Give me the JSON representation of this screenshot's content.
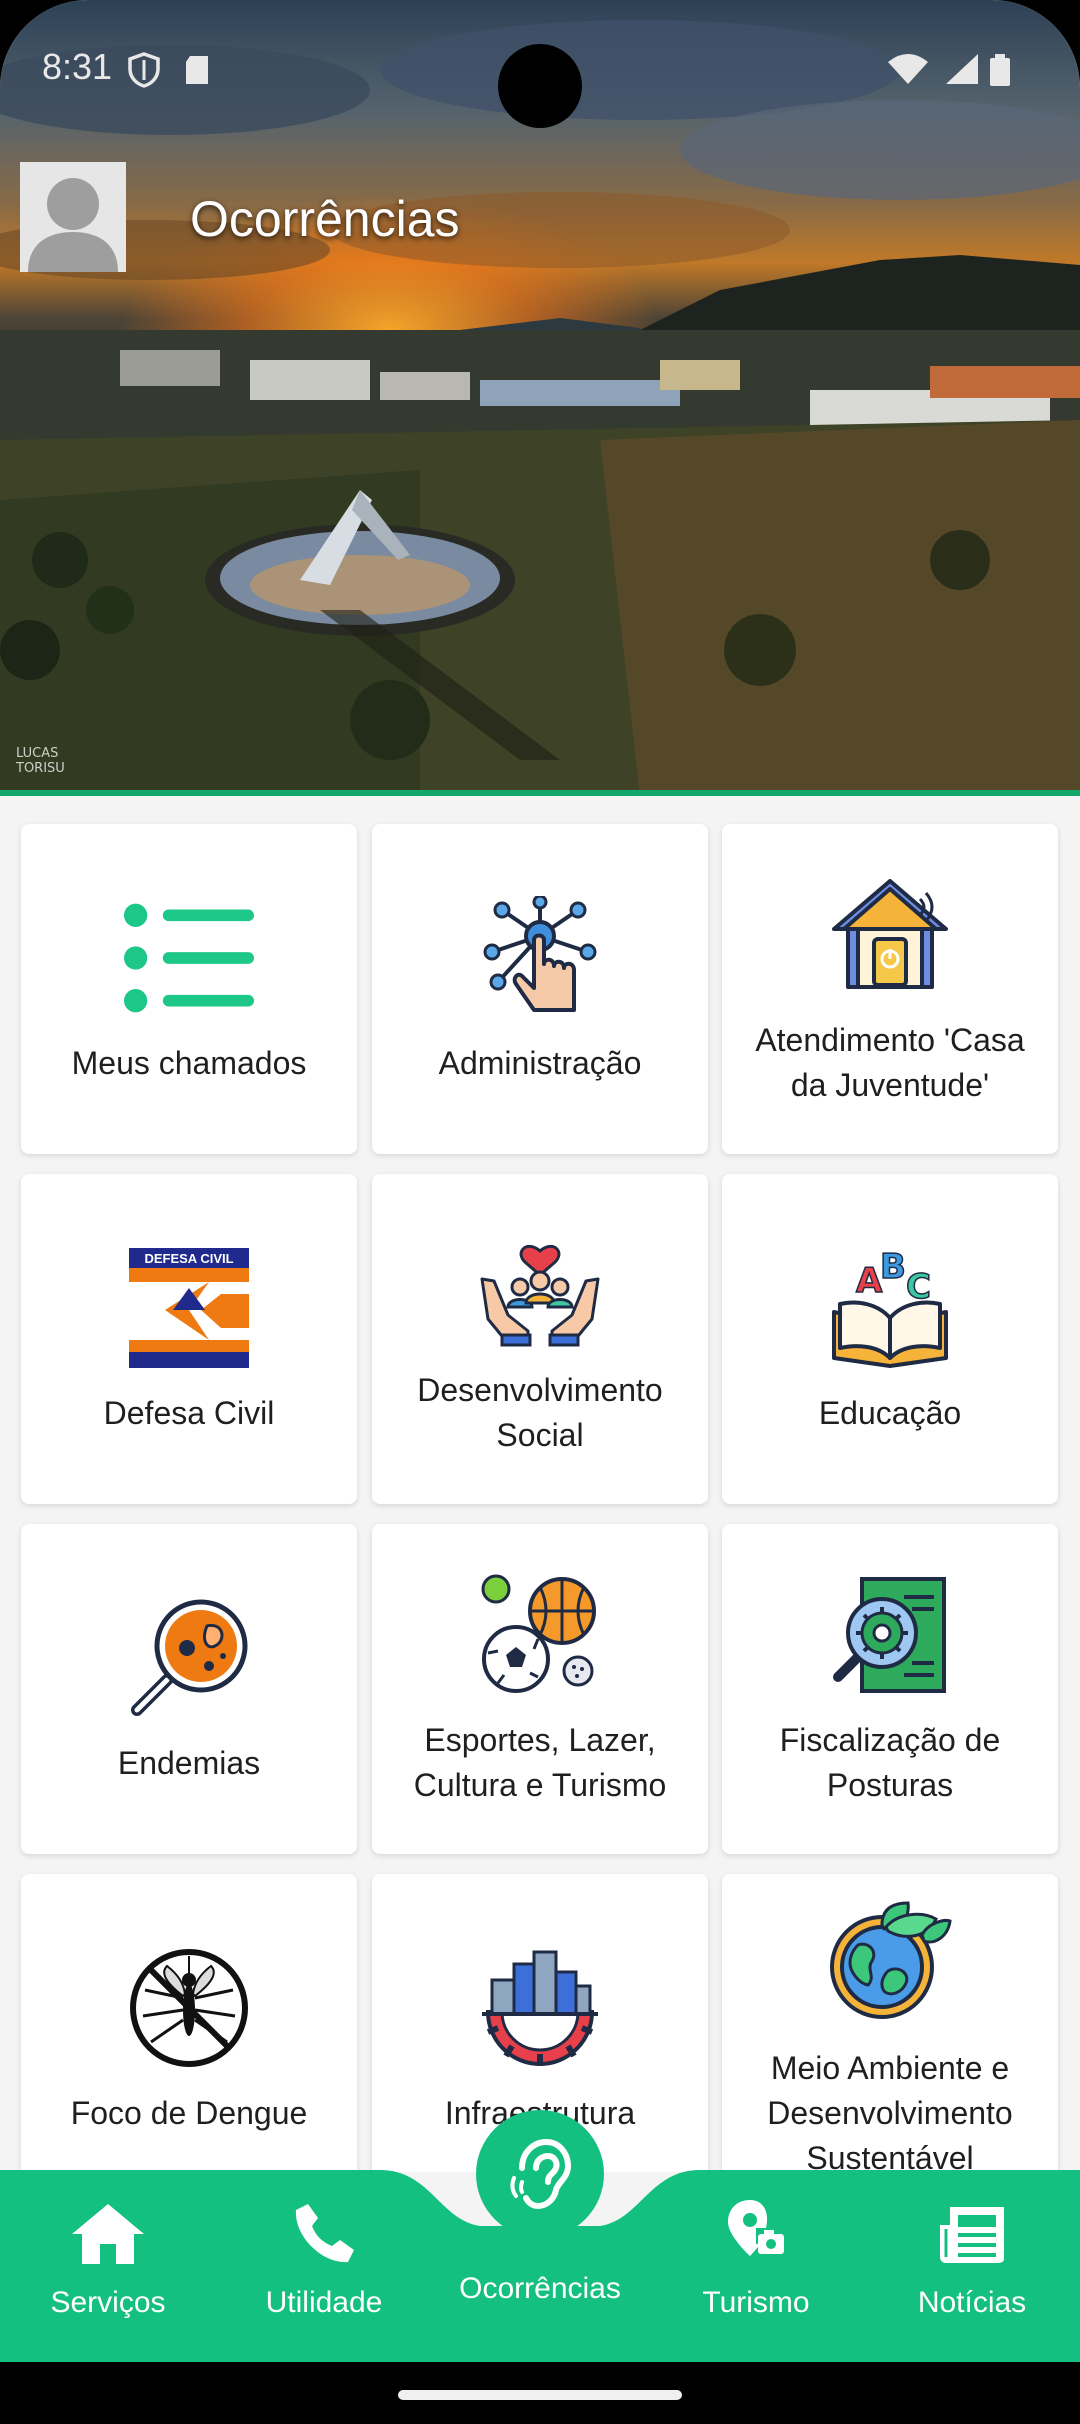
{
  "status_bar": {
    "time": "8:31",
    "left_icons": [
      "shield-icon",
      "sd-card-icon"
    ],
    "right_icons": [
      "wifi-icon",
      "signal-icon",
      "battery-icon"
    ]
  },
  "header": {
    "title": "Ocorrências",
    "avatar_icon": "user-silhouette-icon",
    "photo_credit_line1": "LUCAS",
    "photo_credit_line2": "TORISU"
  },
  "categories": [
    {
      "label": "Meus chamados",
      "icon": "list-icon"
    },
    {
      "label": "Administração",
      "icon": "network-hand-icon"
    },
    {
      "label": "Atendimento 'Casa da Juventude'",
      "icon": "smart-house-icon"
    },
    {
      "label": "Defesa Civil",
      "icon": "defesa-civil-logo"
    },
    {
      "label": "Desenvolvimento Social",
      "icon": "community-care-icon"
    },
    {
      "label": "Educação",
      "icon": "abc-book-icon"
    },
    {
      "label": "Endemias",
      "icon": "magnifier-virus-icon"
    },
    {
      "label": "Esportes, Lazer, Cultura e Turismo",
      "icon": "sports-balls-icon"
    },
    {
      "label": "Fiscalização de Posturas",
      "icon": "document-inspection-icon"
    },
    {
      "label": "Foco de Dengue",
      "icon": "no-mosquito-icon"
    },
    {
      "label": "Infraestrutura",
      "icon": "city-gear-icon"
    },
    {
      "label": "Meio Ambiente e Desenvolvimento Sustentável",
      "icon": "earth-leaves-icon"
    }
  ],
  "defesa_civil_logo_text": "DEFESA CIVIL",
  "bottom_nav": {
    "items": [
      {
        "label": "Serviços",
        "icon": "home-icon"
      },
      {
        "label": "Utilidade",
        "icon": "phone-icon"
      },
      {
        "label": "Ocorrências",
        "icon": "ear-icon",
        "active": true
      },
      {
        "label": "Turismo",
        "icon": "map-pin-camera-icon"
      },
      {
        "label": "Notícias",
        "icon": "newspaper-icon"
      }
    ]
  },
  "colors": {
    "accent": "#14c080",
    "nav_bg": "#14c080",
    "card_bg": "#ffffff",
    "page_bg": "#f4f4f4"
  }
}
